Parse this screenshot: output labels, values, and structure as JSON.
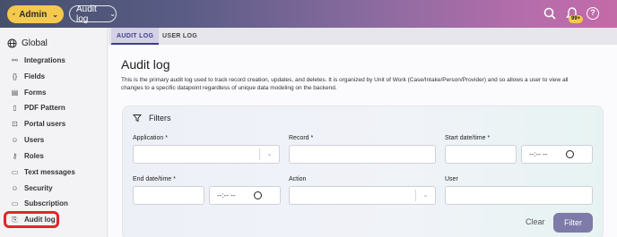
{
  "topbar": {
    "admin_label": "Admin",
    "module_label": "Audit log",
    "notifications_badge": "99+",
    "help_label": "?"
  },
  "sidebar": {
    "global_label": "Global",
    "items": [
      {
        "label": "Integrations",
        "icon": "integrations-icon"
      },
      {
        "label": "Fields",
        "icon": "fields-icon"
      },
      {
        "label": "Forms",
        "icon": "forms-icon"
      },
      {
        "label": "PDF Pattern",
        "icon": "pdf-icon"
      },
      {
        "label": "Portal users",
        "icon": "portal-users-icon"
      },
      {
        "label": "Users",
        "icon": "users-icon"
      },
      {
        "label": "Roles",
        "icon": "roles-icon"
      },
      {
        "label": "Text messages",
        "icon": "text-messages-icon"
      },
      {
        "label": "Security",
        "icon": "security-icon"
      },
      {
        "label": "Subscription",
        "icon": "subscription-icon"
      },
      {
        "label": "Audit log",
        "icon": "audit-log-icon"
      }
    ]
  },
  "tabs": [
    "AUDIT LOG",
    "USER LOG"
  ],
  "page": {
    "title": "Audit log",
    "description": "This is the primary audit log used to track record creation, updates, and deletes. It is organized by Unit of Work (Case/Intake/Person/Provider) and so allows a user to view all changes to a specific datapoint regardless of unique data modeling on the backend."
  },
  "filters": {
    "heading": "Filters",
    "application_label": "Application",
    "record_label": "Record",
    "start_label": "Start date/time",
    "end_label": "End date/time",
    "action_label": "Action",
    "user_label": "User",
    "time_placeholder": "--:-- --",
    "required_mark": "*",
    "clear_label": "Clear",
    "filter_label": "Filter"
  },
  "colors": {
    "admin_button": "#f5c94b",
    "active_tab": "#3f3e88",
    "filter_button": "#7e7aa9",
    "highlight": "#e0272b"
  }
}
